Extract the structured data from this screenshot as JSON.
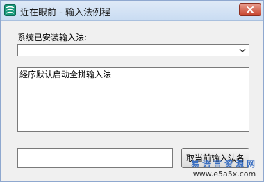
{
  "window": {
    "title": "近在眼前 - 输入法例程"
  },
  "form": {
    "installed_label": "系统已安装输入法:",
    "combo_value": "",
    "text_content": "経序默认启动全拼输入法",
    "name_input_value": "",
    "get_button_label": "取当前输入法名"
  },
  "watermark": {
    "site_name": "易语言资源网",
    "url": "www.e5a5x.com"
  },
  "icons": {
    "app": "app-logo-icon",
    "close": "close-icon",
    "dropdown": "chevron-down-icon"
  },
  "colors": {
    "titlebar": "#c9dcf2",
    "close_button": "#c7452e",
    "watermark_blue": "#3a6fc2"
  }
}
